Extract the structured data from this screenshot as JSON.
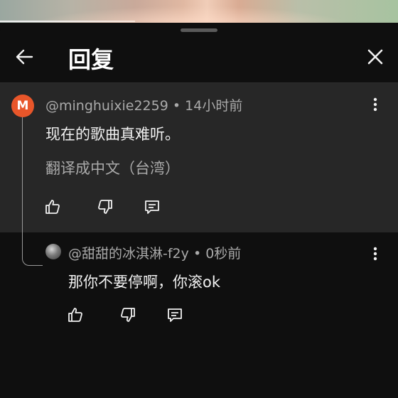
{
  "header": {
    "title": "回复"
  },
  "comment": {
    "avatar_letter": "M",
    "author": "@minghuixie2259",
    "separator": "•",
    "time": "14小时前",
    "text": "现在的歌曲真难听。",
    "translate_label": "翻译成中文（台湾）"
  },
  "reply": {
    "author": "@甜甜的冰淇淋-f2y",
    "separator": "•",
    "time": "0秒前",
    "text": "那你不要停啊，你滚ok"
  },
  "colors": {
    "avatar_bg": "#e8562a",
    "comment_bg": "#272727",
    "page_bg": "#0f0f0f",
    "secondary_text": "#aaaaaa"
  },
  "icons": [
    "back-arrow-icon",
    "close-icon",
    "like-icon",
    "dislike-icon",
    "reply-icon",
    "more-vert-icon"
  ]
}
